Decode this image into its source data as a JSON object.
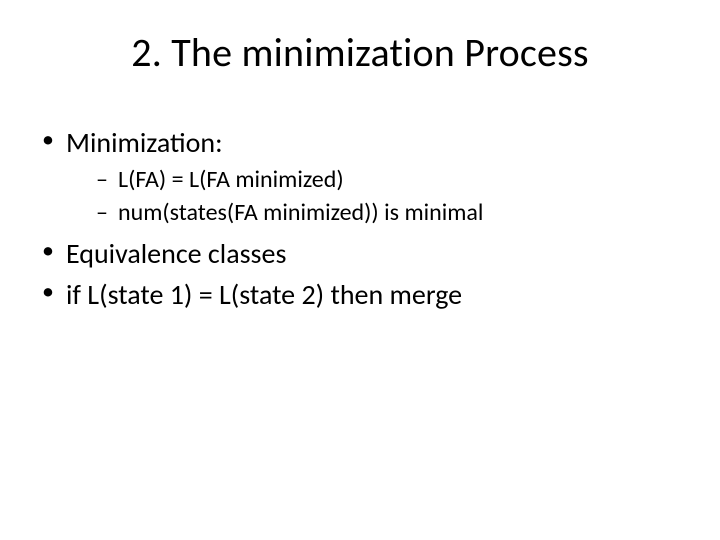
{
  "title": "2. The minimization Process",
  "bullets": {
    "b1": "Minimization:",
    "b1_sub1": "L(FA) = L(FA minimized)",
    "b1_sub2": "num(states(FA minimized)) is minimal",
    "b2": "Equivalence classes",
    "b3": "if L(state 1) = L(state 2) then merge"
  }
}
